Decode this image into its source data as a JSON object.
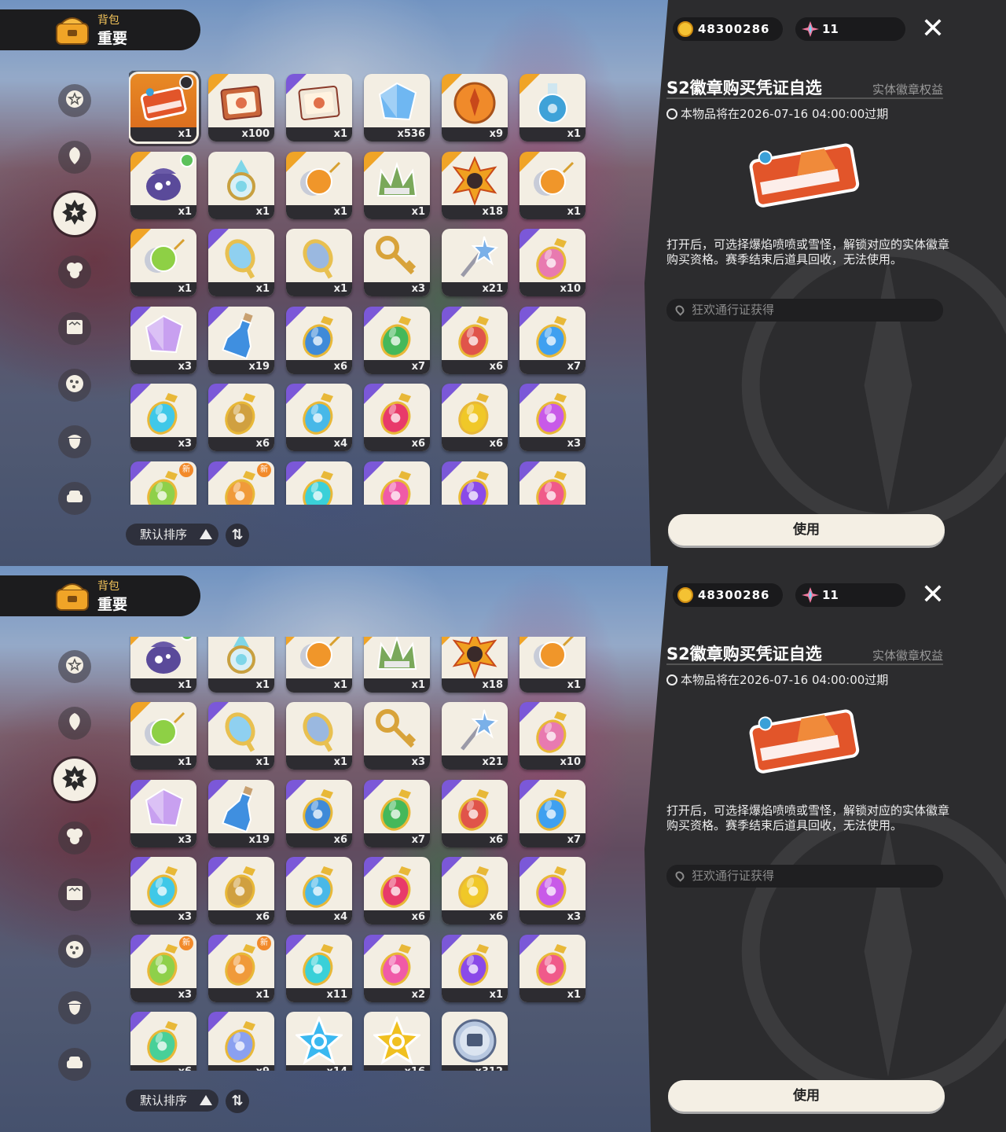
{
  "header": {
    "subtitle": "背包",
    "title": "重要"
  },
  "currency": {
    "coins": "48300286",
    "gems": "11"
  },
  "detail": {
    "title": "S2徽章购买凭证自选",
    "tag": "实体徽章权益",
    "expire": "本物品将在2026-07-16 04:00:00过期",
    "description": "打开后，可选择爆焰喷喷或雪怪，解锁对应的实体徽章购买资格。赛季结束后道具回收，无法使用。",
    "source": "狂欢通行证获得",
    "use_label": "使用"
  },
  "sort": {
    "label": "默认排序",
    "toggle": "⇅"
  },
  "categories": [
    {
      "name": "star-category",
      "icon": "star-icon"
    },
    {
      "name": "leaf-category",
      "icon": "leaf-icon"
    },
    {
      "name": "badge-category",
      "icon": "badge-icon",
      "active": true
    },
    {
      "name": "clover-category",
      "icon": "clover-icon"
    },
    {
      "name": "card-category",
      "icon": "card-icon"
    },
    {
      "name": "dots-category",
      "icon": "dots-icon"
    },
    {
      "name": "acorn-category",
      "icon": "acorn-icon"
    },
    {
      "name": "furniture-category",
      "icon": "sofa-icon"
    }
  ],
  "items": [
    {
      "name": "badge-voucher",
      "qty": "x1",
      "frame": "orange",
      "icon": "ticket",
      "color": "#e2552a",
      "selected": true,
      "badge": "lock"
    },
    {
      "name": "bunny-card",
      "qty": "x100",
      "frame": "orange",
      "icon": "card",
      "color": "#c9663a"
    },
    {
      "name": "letter-card",
      "qty": "x1",
      "frame": "purple",
      "icon": "card",
      "color": "#f0e6d6"
    },
    {
      "name": "prism-crystal",
      "qty": "x536",
      "frame": "",
      "icon": "gem",
      "color": "#6fb7f2"
    },
    {
      "name": "orange-medal",
      "qty": "x9",
      "frame": "orange",
      "icon": "medal",
      "color": "#f08a2a"
    },
    {
      "name": "blue-flask",
      "qty": "x1",
      "frame": "orange",
      "icon": "flask",
      "color": "#3fa2d8"
    },
    {
      "name": "star-pouch",
      "qty": "x1",
      "frame": "orange",
      "icon": "pouch",
      "color": "#5a4a9a",
      "badge": "star"
    },
    {
      "name": "crystal-lamp",
      "qty": "x1",
      "frame": "",
      "icon": "lamp",
      "color": "#7fd6e8"
    },
    {
      "name": "pumpkin-watch",
      "qty": "x1",
      "frame": "orange",
      "icon": "watch",
      "color": "#f0962a"
    },
    {
      "name": "crown-leaf",
      "qty": "x1",
      "frame": "orange",
      "icon": "crown",
      "color": "#7aa85a"
    },
    {
      "name": "sun-badge",
      "qty": "x18",
      "frame": "orange",
      "icon": "sun",
      "color": "#f0a020"
    },
    {
      "name": "pumpkin-watch-2",
      "qty": "x1",
      "frame": "orange",
      "icon": "watch",
      "color": "#f0962a"
    },
    {
      "name": "green-watch",
      "qty": "x1",
      "frame": "orange",
      "icon": "watch",
      "color": "#8ed045"
    },
    {
      "name": "gold-mirror",
      "qty": "x1",
      "frame": "purple",
      "icon": "mirror",
      "color": "#8fd0f0"
    },
    {
      "name": "blue-mirror",
      "qty": "x1",
      "frame": "",
      "icon": "mirror",
      "color": "#9ab8e0"
    },
    {
      "name": "gold-key",
      "qty": "x3",
      "frame": "",
      "icon": "key",
      "color": "#d8a33a"
    },
    {
      "name": "star-wand",
      "qty": "x21",
      "frame": "",
      "icon": "wand",
      "color": "#7ab0e8"
    },
    {
      "name": "rainbow-potion",
      "qty": "x10",
      "frame": "purple",
      "icon": "potion",
      "color": "#e87ab0"
    },
    {
      "name": "rainbow-crystal",
      "qty": "x3",
      "frame": "purple",
      "icon": "gem",
      "color": "#c8a0f0"
    },
    {
      "name": "blue-bottle",
      "qty": "x19",
      "frame": "purple",
      "icon": "bottle",
      "color": "#3f8fe0"
    },
    {
      "name": "blue-star-potion",
      "qty": "x6",
      "frame": "purple",
      "icon": "potion",
      "color": "#3f8ad8"
    },
    {
      "name": "green-potion",
      "qty": "x7",
      "frame": "purple",
      "icon": "potion",
      "color": "#45b85a"
    },
    {
      "name": "red-potion",
      "qty": "x6",
      "frame": "purple",
      "icon": "potion",
      "color": "#e0544a"
    },
    {
      "name": "sky-potion",
      "qty": "x7",
      "frame": "purple",
      "icon": "potion",
      "color": "#3fa0f0"
    },
    {
      "name": "cyan-potion",
      "qty": "x3",
      "frame": "purple",
      "icon": "potion",
      "color": "#3fc8e8"
    },
    {
      "name": "amber-potion",
      "qty": "x6",
      "frame": "purple",
      "icon": "potion",
      "color": "#d0a040"
    },
    {
      "name": "flower-potion",
      "qty": "x4",
      "frame": "purple",
      "icon": "potion",
      "color": "#48b8e8"
    },
    {
      "name": "crown-potion",
      "qty": "x6",
      "frame": "purple",
      "icon": "potion",
      "color": "#e83a6a"
    },
    {
      "name": "yellow-potion",
      "qty": "x6",
      "frame": "purple",
      "icon": "potion",
      "color": "#f0c828"
    },
    {
      "name": "violet-potion",
      "qty": "x3",
      "frame": "purple",
      "icon": "potion",
      "color": "#c85ae8"
    },
    {
      "name": "lime-potion",
      "qty": "x3",
      "frame": "purple",
      "icon": "potion",
      "color": "#8ed04a",
      "badge": "new"
    },
    {
      "name": "orange-potion",
      "qty": "x1",
      "frame": "purple",
      "icon": "potion",
      "color": "#f09a3a",
      "badge": "new"
    },
    {
      "name": "teal-potion",
      "qty": "x11",
      "frame": "purple",
      "icon": "potion",
      "color": "#3ad0d8"
    },
    {
      "name": "pink-potion",
      "qty": "x2",
      "frame": "purple",
      "icon": "potion",
      "color": "#f05aa8"
    },
    {
      "name": "purple-potion",
      "qty": "x1",
      "frame": "purple",
      "icon": "potion",
      "color": "#8a4ae8"
    },
    {
      "name": "rose-potion",
      "qty": "x1",
      "frame": "purple",
      "icon": "potion",
      "color": "#f05a8a"
    },
    {
      "name": "mint-potion",
      "qty": "x6",
      "frame": "purple",
      "icon": "potion",
      "color": "#48d098"
    },
    {
      "name": "swirl-potion",
      "qty": "x9",
      "frame": "purple",
      "icon": "potion",
      "color": "#8aa0f0"
    },
    {
      "name": "blue-star-coin",
      "qty": "x14",
      "frame": "",
      "icon": "star",
      "color": "#3ab8f0"
    },
    {
      "name": "gold-star-coin",
      "qty": "x16",
      "frame": "",
      "icon": "star",
      "color": "#f0c020"
    },
    {
      "name": "silver-token",
      "qty": "x312",
      "frame": "",
      "icon": "coin",
      "color": "#b8c8e0"
    }
  ]
}
